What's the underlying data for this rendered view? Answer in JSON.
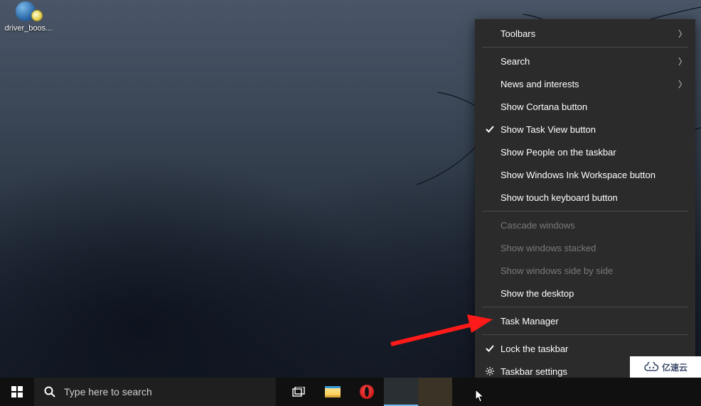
{
  "desktop": {
    "icons": [
      {
        "label": "driver_boos..."
      }
    ]
  },
  "context_menu": {
    "groups": [
      [
        {
          "id": "toolbars",
          "label": "Toolbars",
          "submenu": true
        }
      ],
      [
        {
          "id": "search",
          "label": "Search",
          "submenu": true
        },
        {
          "id": "news",
          "label": "News and interests",
          "submenu": true
        },
        {
          "id": "cortana",
          "label": "Show Cortana button"
        },
        {
          "id": "taskview",
          "label": "Show Task View button",
          "checked": true
        },
        {
          "id": "people",
          "label": "Show People on the taskbar"
        },
        {
          "id": "ink",
          "label": "Show Windows Ink Workspace button"
        },
        {
          "id": "touchkb",
          "label": "Show touch keyboard button"
        }
      ],
      [
        {
          "id": "cascade",
          "label": "Cascade windows",
          "disabled": true
        },
        {
          "id": "stacked",
          "label": "Show windows stacked",
          "disabled": true
        },
        {
          "id": "sidebyside",
          "label": "Show windows side by side",
          "disabled": true
        },
        {
          "id": "showdesktop",
          "label": "Show the desktop"
        }
      ],
      [
        {
          "id": "taskmgr",
          "label": "Task Manager"
        }
      ],
      [
        {
          "id": "lock",
          "label": "Lock the taskbar",
          "checked": true
        },
        {
          "id": "settings",
          "label": "Taskbar settings",
          "icon": "gear"
        }
      ]
    ]
  },
  "taskbar": {
    "search_placeholder": "Type here to search"
  },
  "watermark": {
    "text": "亿速云"
  }
}
